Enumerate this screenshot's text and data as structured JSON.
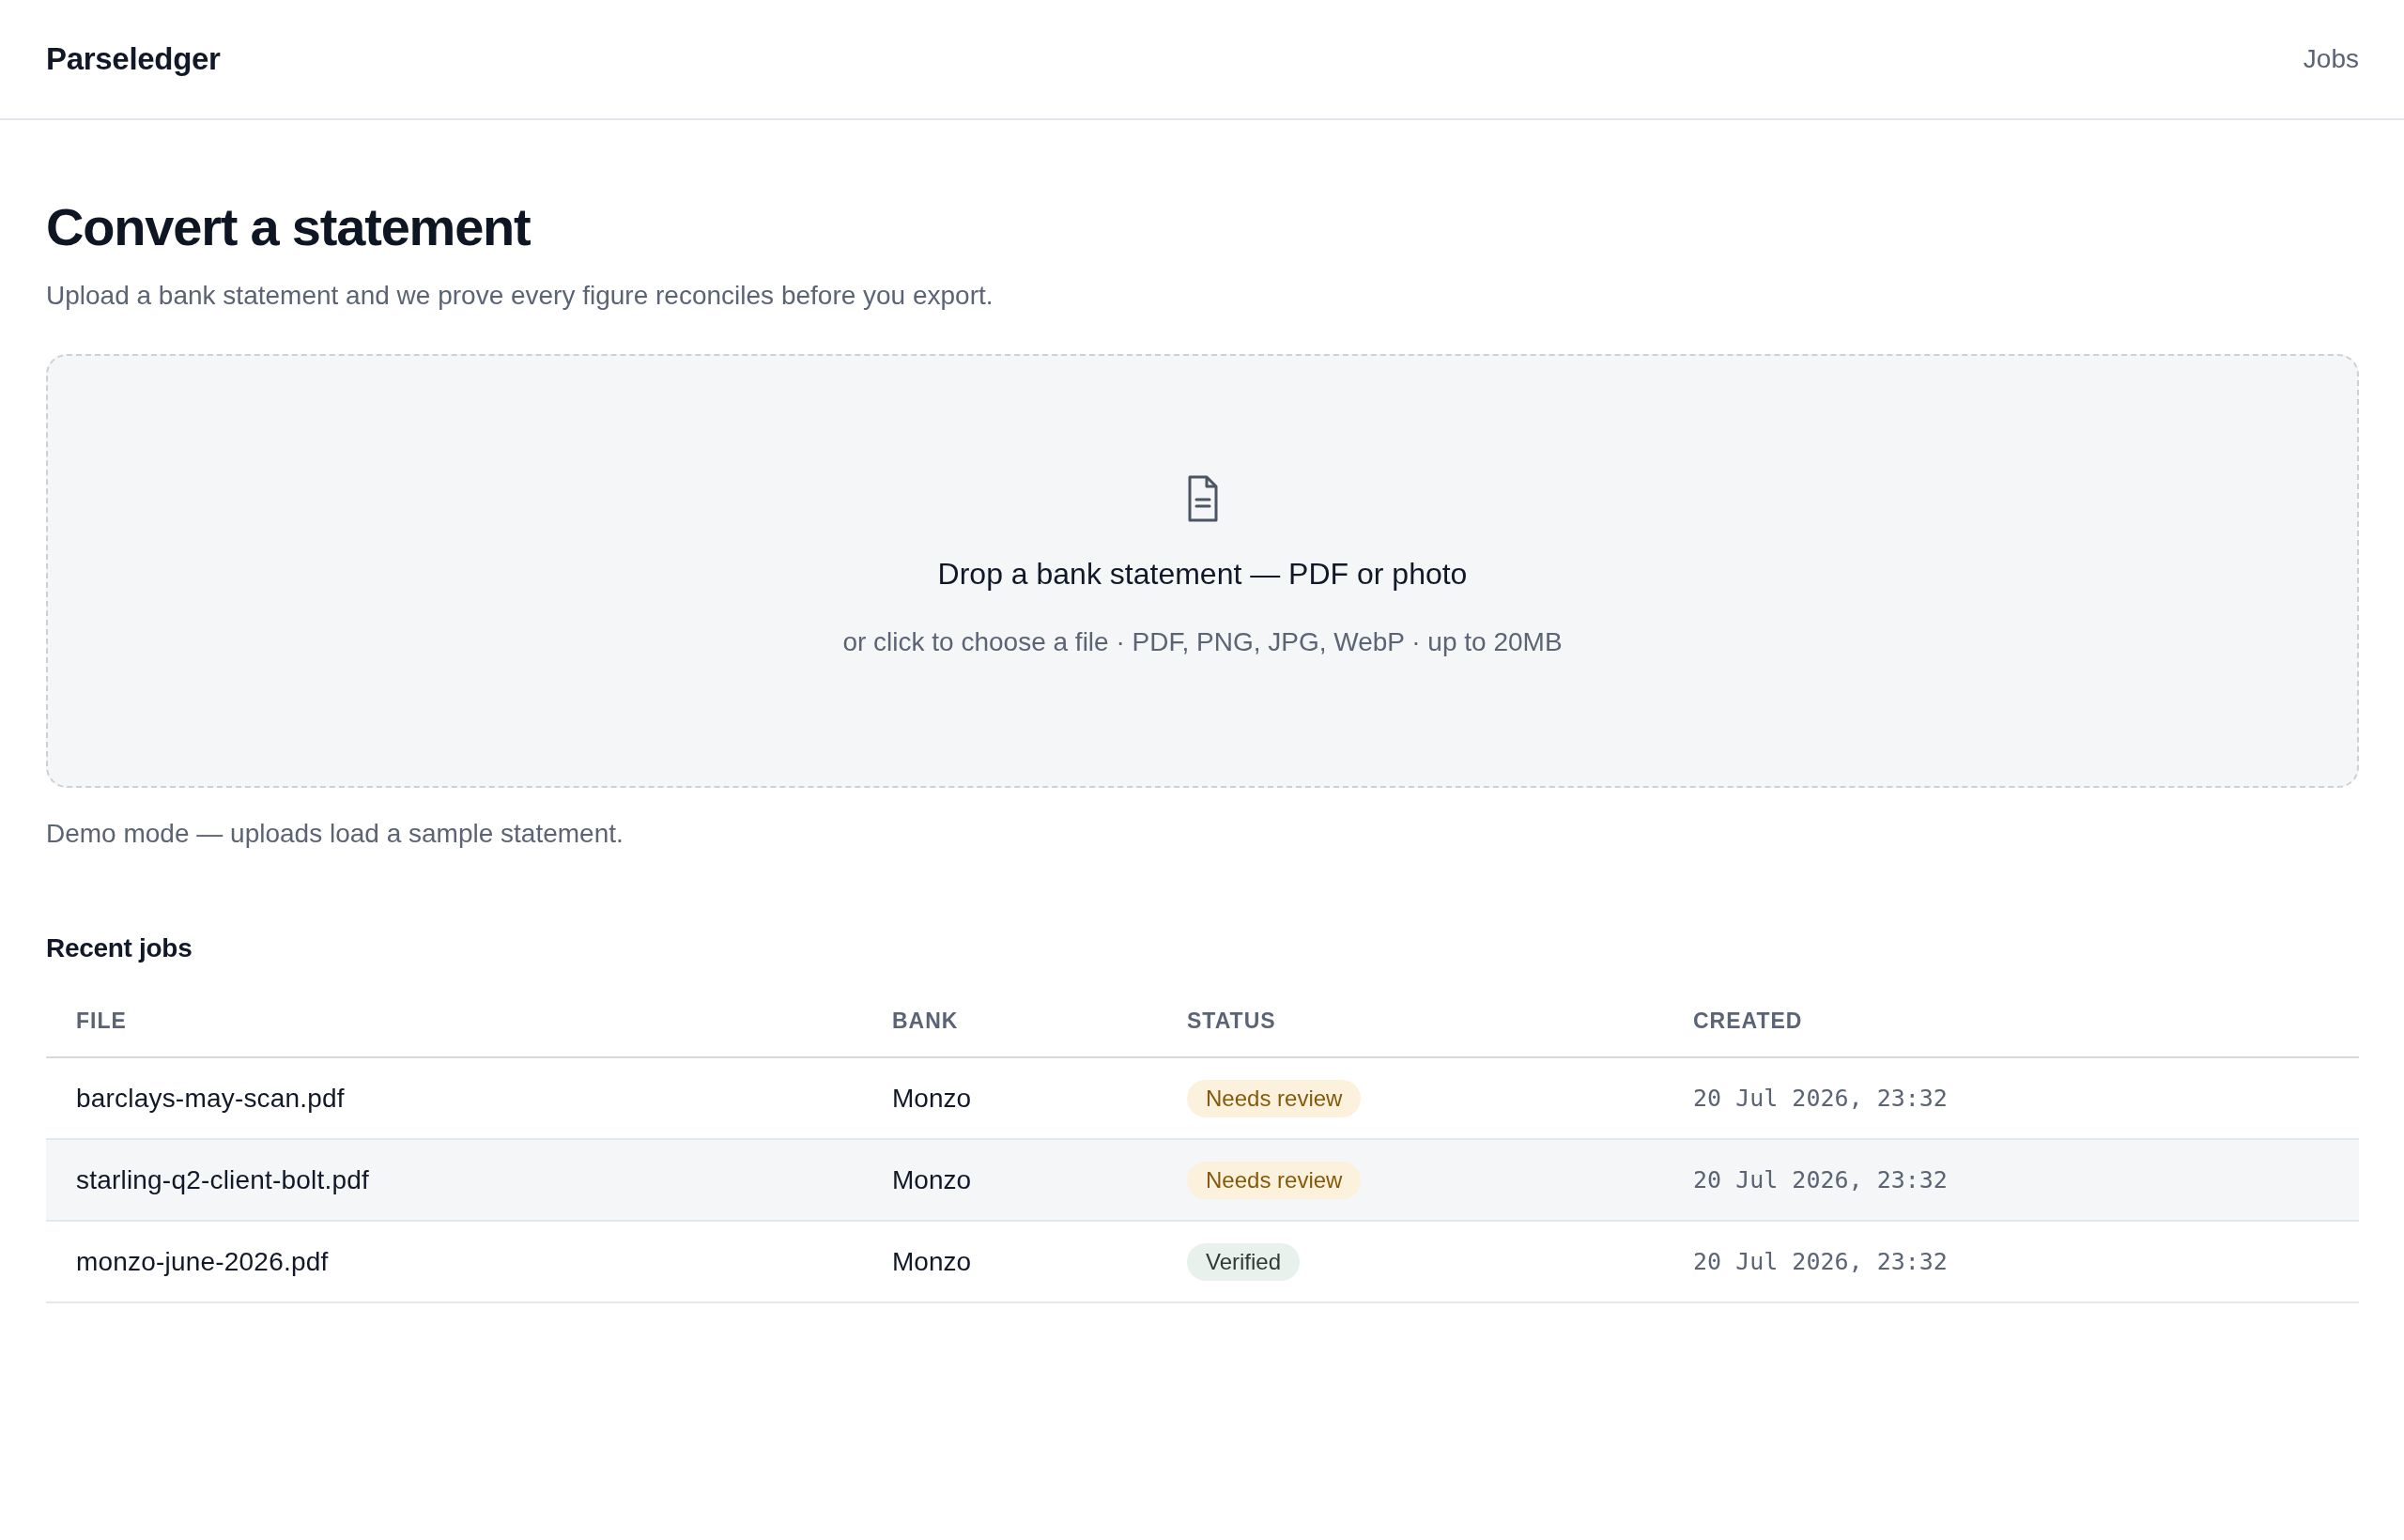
{
  "header": {
    "logo": "Parseledger",
    "nav": [
      "Jobs"
    ]
  },
  "page": {
    "title": "Convert a statement",
    "subtitle": "Upload a bank statement and we prove every figure reconciles before you export."
  },
  "dropzone": {
    "title": "Drop a bank statement — PDF or photo",
    "hint": "or click to choose a file · PDF, PNG, JPG, WebP · up to 20MB"
  },
  "demo_note": "Demo mode — uploads load a sample statement.",
  "recent_jobs": {
    "title": "Recent jobs",
    "columns": [
      "FILE",
      "BANK",
      "STATUS",
      "CREATED"
    ],
    "rows": [
      {
        "file": "barclays-may-scan.pdf",
        "bank": "Monzo",
        "status": {
          "label": "Needs review",
          "kind": "warning"
        },
        "created": "20 Jul 2026, 23:32"
      },
      {
        "file": "starling-q2-client-bolt.pdf",
        "bank": "Monzo",
        "status": {
          "label": "Needs review",
          "kind": "warning"
        },
        "created": "20 Jul 2026, 23:32"
      },
      {
        "file": "monzo-june-2026.pdf",
        "bank": "Monzo",
        "status": {
          "label": "Verified",
          "kind": "success"
        },
        "created": "20 Jul 2026, 23:32"
      }
    ]
  }
}
